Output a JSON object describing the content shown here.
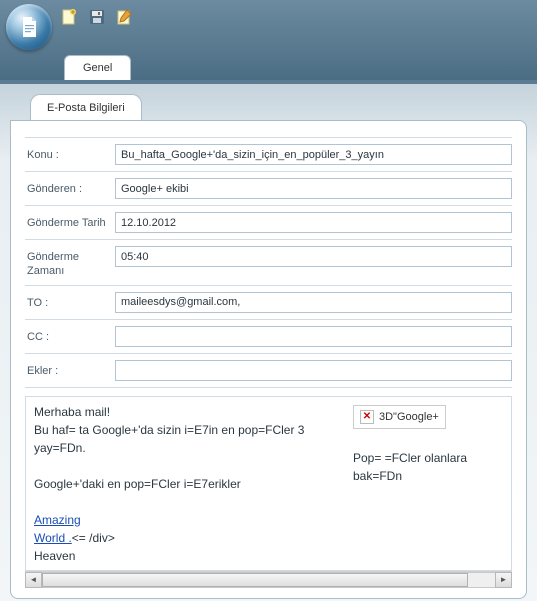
{
  "toolbar": {
    "main_tab": "Genel"
  },
  "inner_tab": "E-Posta Bilgileri",
  "fields": {
    "konu": {
      "label": "Konu :",
      "value": "Bu_hafta_Google+'da_sizin_için_en_popüler_3_yayın"
    },
    "gonderen": {
      "label": "Gönderen :",
      "value": "Google+ ekibi"
    },
    "gonderme_tarih": {
      "label": "Gönderme Tarih",
      "value": "12.10.2012"
    },
    "gonderme_zamani": {
      "label": "Gönderme Zamanı",
      "value": "05:40"
    },
    "to": {
      "label": "TO :",
      "value": "maileesdys@gmail.com,"
    },
    "cc": {
      "label": "CC :",
      "value": ""
    },
    "ekler": {
      "label": "Ekler :",
      "value": ""
    }
  },
  "body": {
    "greeting": "Merhaba mail!",
    "line1": "Bu haf= ta Google+'da sizin i=E7in en pop=FCler 3 yay=FDn.",
    "line2": "Google+'daki en pop=FCler i=E7erikler",
    "link1": "Amazing",
    "link2_text": "World .",
    "link2_suffix": "<= /div>",
    "line3": "Heaven",
    "img_alt": "3D\"Google+",
    "right_text": "Pop= =FCler olanlara bak=FDn"
  }
}
